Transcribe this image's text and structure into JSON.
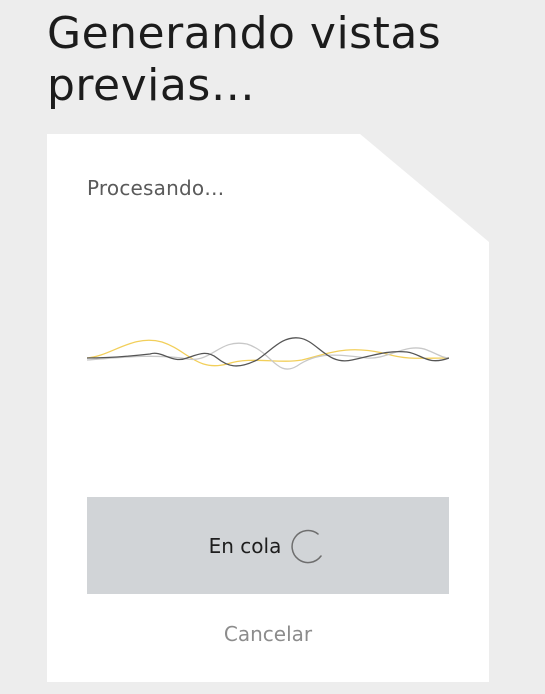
{
  "page": {
    "title": "Generando vistas previas…"
  },
  "card": {
    "status_text": "Procesando…",
    "waveform_icon": "audio-waveform-icon",
    "queue_label": "En cola",
    "spinner_icon": "loading-spinner-icon",
    "cancel_label": "Cancelar"
  },
  "colors": {
    "background": "#ededed",
    "card": "#ffffff",
    "queue_bar": "#d1d4d7",
    "wave_dark": "#555555",
    "wave_light": "#c8c8c8",
    "wave_accent": "#f2cf5a",
    "cancel_text": "#8c8c8c"
  }
}
